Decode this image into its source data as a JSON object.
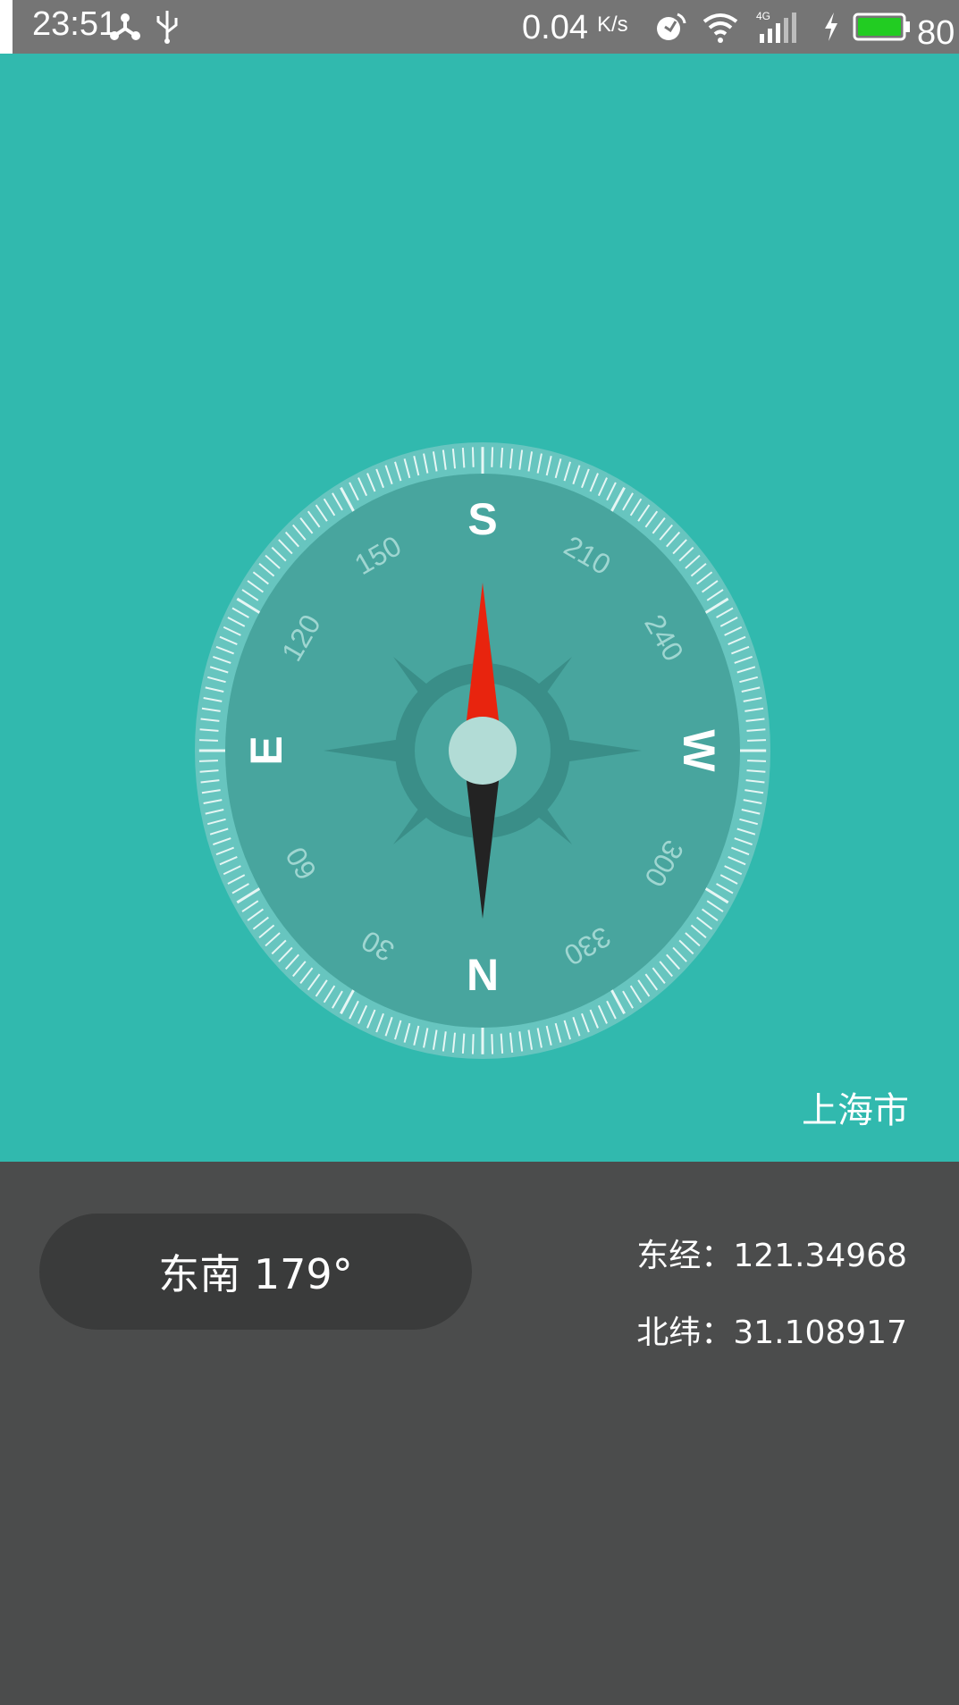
{
  "status_bar": {
    "time": "23:51",
    "net_speed": "0.04",
    "net_speed_unit": "K/s",
    "battery_level": "80",
    "icons": [
      "share-icon",
      "usb-icon",
      "sync-icon",
      "wifi-icon",
      "cellular-4g-icon",
      "charging-icon",
      "battery-icon"
    ],
    "battery_color": "#22cc22",
    "background_color": "#757575"
  },
  "compass": {
    "cardinals": {
      "north": "N",
      "south": "S",
      "east": "E",
      "west": "W"
    },
    "degree_labels": [
      "30",
      "60",
      "120",
      "150",
      "210",
      "240",
      "300",
      "330"
    ],
    "needle_colors": {
      "north": "#e8240e",
      "south": "#232323"
    },
    "background_color": "#31b9ae"
  },
  "location": {
    "city": "上海市"
  },
  "heading": {
    "text": "东南 179°"
  },
  "coordinates": {
    "longitude_label": "东经：",
    "longitude_value": "121.34968",
    "latitude_label": "北纬：",
    "latitude_value": "31.108917"
  }
}
